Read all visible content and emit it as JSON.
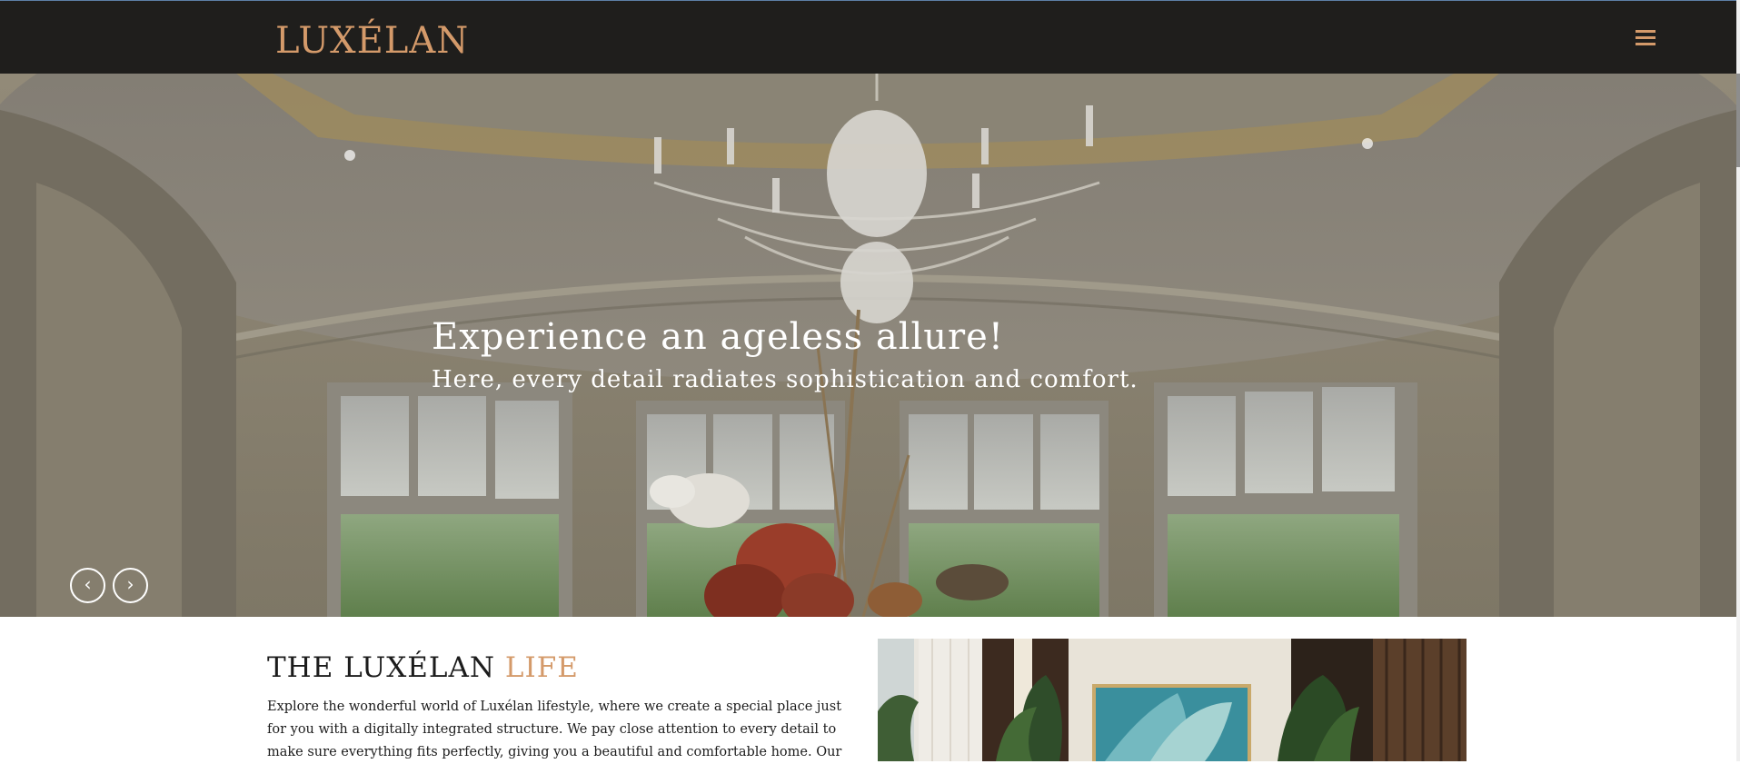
{
  "header": {
    "logo_text": "LUXÉLAN",
    "menu_icon": "hamburger-menu-icon"
  },
  "hero": {
    "title": "Experience an ageless allure!",
    "subtitle": "Here, every detail radiates sophistication and comfort.",
    "prev_icon": "chevron-left-icon",
    "next_icon": "chevron-right-icon",
    "prev_glyph": "‹",
    "next_glyph": "›"
  },
  "intro": {
    "heading_main": "THE LUXÉLAN ",
    "heading_accent": "LIFE",
    "paragraph": "Explore the wonderful world of Luxélan lifestyle, where we create a special place just for you with a digitally integrated structure. We pay close attention to every detail to make sure everything fits perfectly, giving you a beautiful and comfortable home. Our"
  },
  "colors": {
    "header_bg": "#1f1e1c",
    "accent": "#d49a6a",
    "text_dark": "#1c1c1c"
  }
}
